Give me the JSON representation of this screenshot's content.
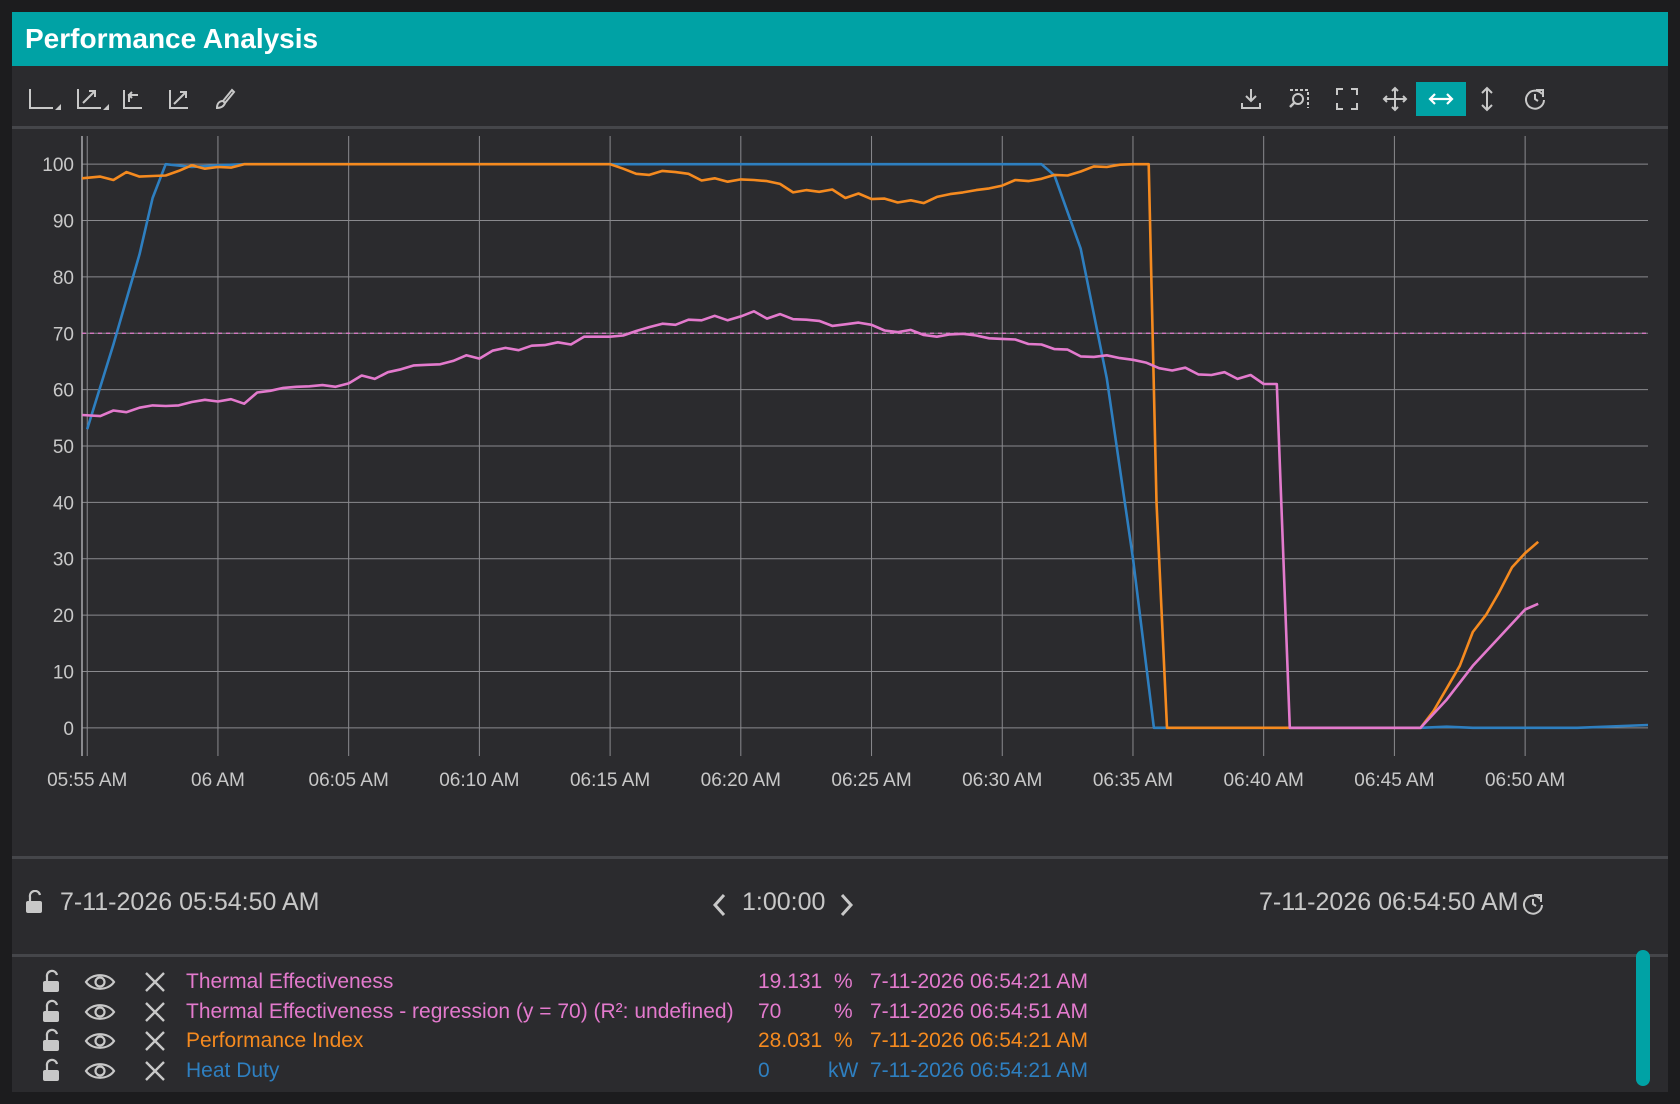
{
  "window": {
    "title": "Performance Analysis"
  },
  "toolbar": {
    "left_icons": [
      "axis-select-icon",
      "axis-scale-icon",
      "axis-reset-icon",
      "expand-axes-icon",
      "brush-icon"
    ],
    "right_icons": [
      "download-icon",
      "zoom-select-icon",
      "fullscreen-icon",
      "pan-icon",
      "horizontal-zoom-icon",
      "vertical-zoom-icon",
      "refresh-icon"
    ],
    "active_tool": "horizontal-zoom-icon"
  },
  "chart_data": {
    "type": "line",
    "x_tick_labels": [
      "05:55 AM",
      "06 AM",
      "06:05 AM",
      "06:10 AM",
      "06:15 AM",
      "06:20 AM",
      "06:25 AM",
      "06:30 AM",
      "06:35 AM",
      "06:40 AM",
      "06:45 AM",
      "06:50 AM"
    ],
    "y_tick_labels": [
      "0",
      "10",
      "20",
      "30",
      "40",
      "50",
      "60",
      "70",
      "80",
      "90",
      "100"
    ],
    "xlim_minutes": [
      -0.2,
      59.7
    ],
    "ylim": [
      -5,
      105
    ],
    "grid": true,
    "series": [
      {
        "name": "Heat Duty",
        "color": "#2e7fc0",
        "points": [
          [
            0.0,
            53
          ],
          [
            1.0,
            68
          ],
          [
            2.0,
            84
          ],
          [
            2.5,
            94
          ],
          [
            3.0,
            100
          ],
          [
            4.0,
            99.5
          ],
          [
            5.0,
            99.8
          ],
          [
            6.0,
            100
          ],
          [
            20.0,
            100
          ],
          [
            36.5,
            100
          ],
          [
            37.0,
            98
          ],
          [
            38.0,
            85
          ],
          [
            39.0,
            62
          ],
          [
            40.0,
            30
          ],
          [
            40.8,
            0
          ],
          [
            41.5,
            0
          ],
          [
            51.0,
            0
          ],
          [
            52.0,
            0.2
          ],
          [
            53.0,
            0
          ],
          [
            57.0,
            0
          ],
          [
            59.7,
            0.5
          ]
        ]
      },
      {
        "name": "Performance Index",
        "color": "#f58a1f",
        "points": [
          [
            -0.2,
            97.5
          ],
          [
            0.5,
            97.8
          ],
          [
            1.0,
            97.2
          ],
          [
            1.5,
            98.6
          ],
          [
            2.0,
            97.8
          ],
          [
            2.5,
            97.9
          ],
          [
            3.0,
            98.0
          ],
          [
            3.5,
            98.8
          ],
          [
            4.0,
            99.8
          ],
          [
            4.5,
            99.2
          ],
          [
            5.0,
            99.5
          ],
          [
            5.5,
            99.4
          ],
          [
            6.0,
            100
          ],
          [
            20.0,
            100
          ],
          [
            20.5,
            99.2
          ],
          [
            21.0,
            98.3
          ],
          [
            21.5,
            98.1
          ],
          [
            22.0,
            98.8
          ],
          [
            22.5,
            98.6
          ],
          [
            23.0,
            98.3
          ],
          [
            23.5,
            97.1
          ],
          [
            24.0,
            97.5
          ],
          [
            24.5,
            96.9
          ],
          [
            25.0,
            97.3
          ],
          [
            25.5,
            97.2
          ],
          [
            26.0,
            97.0
          ],
          [
            26.5,
            96.5
          ],
          [
            27.0,
            95.0
          ],
          [
            27.5,
            95.4
          ],
          [
            28.0,
            95.1
          ],
          [
            28.5,
            95.5
          ],
          [
            29.0,
            94.0
          ],
          [
            29.5,
            94.8
          ],
          [
            30.0,
            93.8
          ],
          [
            30.5,
            93.9
          ],
          [
            31.0,
            93.2
          ],
          [
            31.5,
            93.6
          ],
          [
            32.0,
            93.1
          ],
          [
            32.5,
            94.2
          ],
          [
            33.0,
            94.7
          ],
          [
            33.5,
            95.0
          ],
          [
            34.0,
            95.4
          ],
          [
            34.5,
            95.7
          ],
          [
            35.0,
            96.2
          ],
          [
            35.5,
            97.2
          ],
          [
            36.0,
            97.0
          ],
          [
            36.5,
            97.4
          ],
          [
            37.0,
            98.1
          ],
          [
            37.5,
            98.0
          ],
          [
            38.0,
            98.7
          ],
          [
            38.5,
            99.6
          ],
          [
            39.0,
            99.5
          ],
          [
            39.5,
            99.9
          ],
          [
            40.0,
            100
          ],
          [
            40.6,
            100
          ],
          [
            40.9,
            40
          ],
          [
            41.3,
            0
          ],
          [
            51.0,
            0
          ],
          [
            51.5,
            3
          ],
          [
            52.0,
            7
          ],
          [
            52.5,
            11
          ],
          [
            53.0,
            17
          ],
          [
            53.5,
            20
          ],
          [
            54.0,
            24
          ],
          [
            54.5,
            28.5
          ],
          [
            55.0,
            31
          ],
          [
            55.5,
            33
          ]
        ]
      },
      {
        "name": "Thermal Effectiveness",
        "color": "#e37acd",
        "points": [
          [
            -0.2,
            55.5
          ],
          [
            0.5,
            55.3
          ],
          [
            1.0,
            56.3
          ],
          [
            1.5,
            56.0
          ],
          [
            2.0,
            56.8
          ],
          [
            2.5,
            57.2
          ],
          [
            3.0,
            57.1
          ],
          [
            3.5,
            57.2
          ],
          [
            4.0,
            57.8
          ],
          [
            4.5,
            58.2
          ],
          [
            5.0,
            57.9
          ],
          [
            5.5,
            58.3
          ],
          [
            6.0,
            57.5
          ],
          [
            6.5,
            59.5
          ],
          [
            7.0,
            59.8
          ],
          [
            7.5,
            60.3
          ],
          [
            8.0,
            60.5
          ],
          [
            8.5,
            60.6
          ],
          [
            9.0,
            60.8
          ],
          [
            9.5,
            60.5
          ],
          [
            10.0,
            61.1
          ],
          [
            10.5,
            62.5
          ],
          [
            11.0,
            61.9
          ],
          [
            11.5,
            63.1
          ],
          [
            12.0,
            63.6
          ],
          [
            12.5,
            64.3
          ],
          [
            13.0,
            64.4
          ],
          [
            13.5,
            64.5
          ],
          [
            14.0,
            65.1
          ],
          [
            14.5,
            66.1
          ],
          [
            15.0,
            65.5
          ],
          [
            15.5,
            66.9
          ],
          [
            16.0,
            67.4
          ],
          [
            16.5,
            67.0
          ],
          [
            17.0,
            67.8
          ],
          [
            17.5,
            67.9
          ],
          [
            18.0,
            68.4
          ],
          [
            18.5,
            68.0
          ],
          [
            19.0,
            69.4
          ],
          [
            19.5,
            69.4
          ],
          [
            20.0,
            69.4
          ],
          [
            20.5,
            69.6
          ],
          [
            21.0,
            70.4
          ],
          [
            21.5,
            71.1
          ],
          [
            22.0,
            71.7
          ],
          [
            22.5,
            71.5
          ],
          [
            23.0,
            72.4
          ],
          [
            23.5,
            72.3
          ],
          [
            24.0,
            73.1
          ],
          [
            24.5,
            72.3
          ],
          [
            25.0,
            73.0
          ],
          [
            25.5,
            73.9
          ],
          [
            26.0,
            72.6
          ],
          [
            26.5,
            73.4
          ],
          [
            27.0,
            72.5
          ],
          [
            27.5,
            72.4
          ],
          [
            28.0,
            72.2
          ],
          [
            28.5,
            71.3
          ],
          [
            29.0,
            71.6
          ],
          [
            29.5,
            71.9
          ],
          [
            30.0,
            71.5
          ],
          [
            30.5,
            70.5
          ],
          [
            31.0,
            70.2
          ],
          [
            31.5,
            70.6
          ],
          [
            32.0,
            69.7
          ],
          [
            32.5,
            69.4
          ],
          [
            33.0,
            69.8
          ],
          [
            33.5,
            69.9
          ],
          [
            34.0,
            69.6
          ],
          [
            34.5,
            69.1
          ],
          [
            35.0,
            69.0
          ],
          [
            35.5,
            68.9
          ],
          [
            36.0,
            68.1
          ],
          [
            36.5,
            68.0
          ],
          [
            37.0,
            67.2
          ],
          [
            37.5,
            67.1
          ],
          [
            38.0,
            65.9
          ],
          [
            38.5,
            65.8
          ],
          [
            39.0,
            66.1
          ],
          [
            39.5,
            65.6
          ],
          [
            40.0,
            65.3
          ],
          [
            40.5,
            64.8
          ],
          [
            41.0,
            63.8
          ],
          [
            41.5,
            63.4
          ],
          [
            42.0,
            63.9
          ],
          [
            42.5,
            62.7
          ],
          [
            43.0,
            62.6
          ],
          [
            43.5,
            63.1
          ],
          [
            44.0,
            61.9
          ],
          [
            44.5,
            62.6
          ],
          [
            45.0,
            61.0
          ],
          [
            45.5,
            61.0
          ],
          [
            46.0,
            0
          ],
          [
            51.0,
            0
          ],
          [
            52.0,
            5
          ],
          [
            53.0,
            11
          ],
          [
            54.0,
            16
          ],
          [
            55.0,
            21
          ],
          [
            55.5,
            22
          ]
        ]
      }
    ],
    "regression_line": {
      "name": "Thermal Effectiveness - regression (y = 70) (R²: undefined)",
      "y": 70,
      "color": "#e37acd"
    }
  },
  "time_range": {
    "start": "7-11-2026 05:54:50 AM",
    "duration": "1:00:00",
    "end": "7-11-2026 06:54:50 AM"
  },
  "legend": [
    {
      "name": "Thermal Effectiveness",
      "value": "19.131",
      "unit": "%",
      "timestamp": "7-11-2026 06:54:21 AM",
      "color": "#e37acd"
    },
    {
      "name": "Thermal Effectiveness - regression (y = 70) (R²: undefined)",
      "value": "70",
      "unit": "%",
      "timestamp": "7-11-2026 06:54:51 AM",
      "color": "#e37acd"
    },
    {
      "name": "Performance Index",
      "value": "28.031",
      "unit": "%",
      "timestamp": "7-11-2026 06:54:21 AM",
      "color": "#f58a1f"
    },
    {
      "name": "Heat Duty",
      "value": "0",
      "unit": "kW",
      "timestamp": "7-11-2026 06:54:21 AM",
      "color": "#2e7fc0"
    }
  ]
}
